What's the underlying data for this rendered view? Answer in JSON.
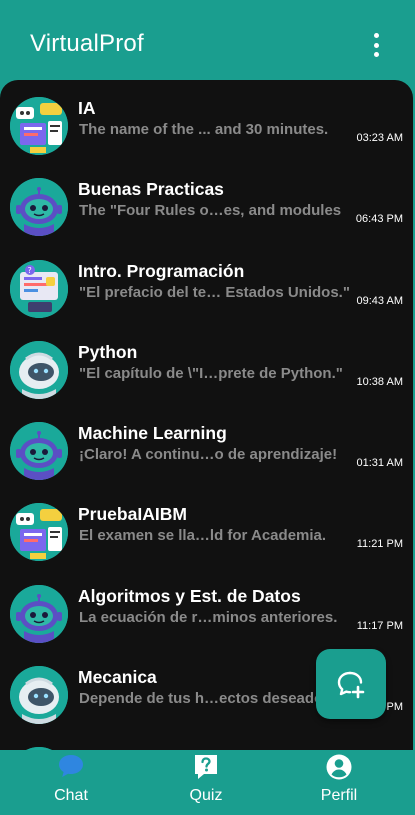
{
  "app": {
    "title": "VirtualProf"
  },
  "chats": [
    {
      "title": "IA",
      "preview": "The name of the ... and 30 minutes.",
      "time": "03:23 AM",
      "avatar": "chat-collage-icon"
    },
    {
      "title": "Buenas Practicas",
      "preview": "The \"Four Rules o…es, and modules",
      "time": "06:43 PM",
      "avatar": "robot-icon"
    },
    {
      "title": "Intro. Programación",
      "preview": "\"El prefacio del te… Estados Unidos.\"",
      "time": "09:43 AM",
      "avatar": "code-screen-icon"
    },
    {
      "title": "Python",
      "preview": "\"El capítulo de \\\"I…prete de Python.\"",
      "time": "10:38 AM",
      "avatar": "white-robot-icon"
    },
    {
      "title": "Machine Learning",
      "preview": "¡Claro! A continu…o de aprendizaje!",
      "time": "01:31 AM",
      "avatar": "robot-icon"
    },
    {
      "title": "PruebaIAIBM",
      "preview": "El examen se lla…ld for Academia.",
      "time": "11:21 PM",
      "avatar": "chat-collage-icon"
    },
    {
      "title": "Algoritmos y Est. de Datos",
      "preview": "La ecuación de r…minos anteriores.",
      "time": "11:17 PM",
      "avatar": "robot-icon"
    },
    {
      "title": "Mecanica",
      "preview": "Depende de tus h…ectos deseados.",
      "time": "04:11 PM",
      "avatar": "white-robot-icon"
    }
  ],
  "fab": {
    "icon": "new-chat-icon"
  },
  "nav": {
    "chat": "Chat",
    "quiz": "Quiz",
    "perfil": "Perfil"
  },
  "colors": {
    "accent": "#1a9e8f",
    "background": "#111111",
    "preview_text": "#8a8a8a"
  }
}
